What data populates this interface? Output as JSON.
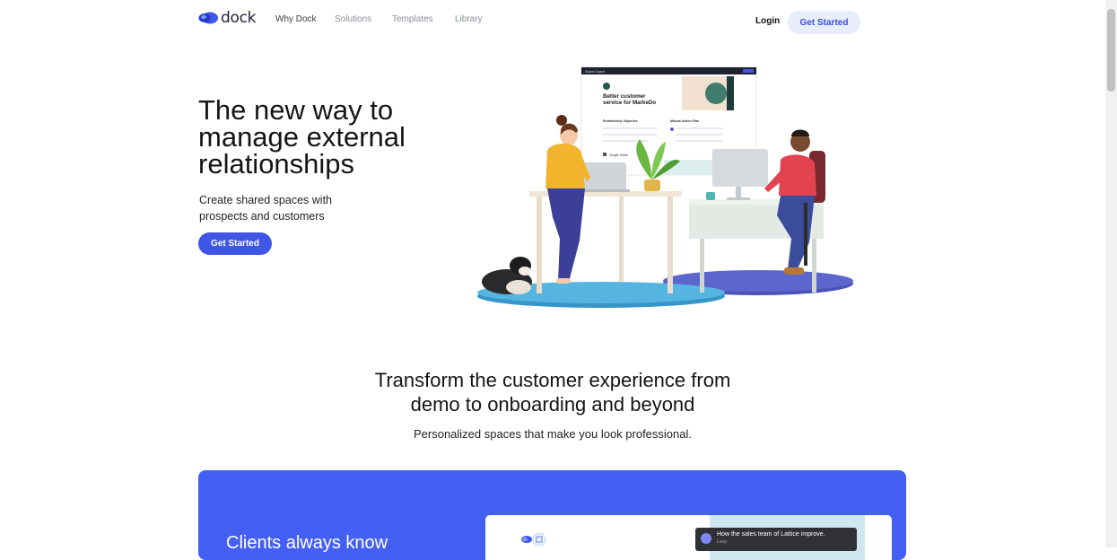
{
  "nav": {
    "brand": "dock",
    "links": [
      "Why Dock",
      "Solutions",
      "Templates",
      "Library"
    ],
    "login": "Login",
    "cta": "Get Started"
  },
  "hero": {
    "title": "The new way to manage external relationships",
    "subtitle": "Create shared spaces with prospects and customers",
    "cta": "Get Started",
    "illustration": {
      "window_label": "Shared Space",
      "card_title": "Better customer service for MarkeDo",
      "col1": "Relationship Objective",
      "col2": "Mutual Action Plan",
      "slides_label": "Google Slides"
    }
  },
  "section": {
    "title": "Transform the customer experience from demo to onboarding and beyond",
    "subtitle": "Personalized spaces that make you look professional."
  },
  "feature": {
    "heading": "Clients always know",
    "toast_title": "How the sales team of Lattice improve.",
    "toast_sub": "Loop"
  },
  "colors": {
    "brand_blue": "#3f56e6",
    "feature_bg": "#4460f2",
    "nav_cta_bg": "#e8ecfb"
  }
}
